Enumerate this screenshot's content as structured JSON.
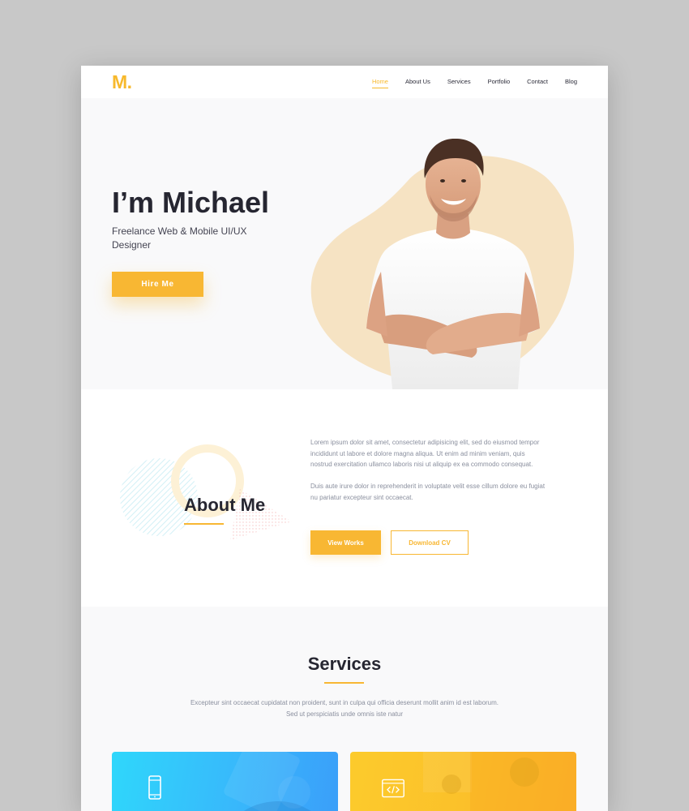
{
  "nav": {
    "logo": "M.",
    "items": [
      {
        "label": "Home",
        "active": true
      },
      {
        "label": "About Us"
      },
      {
        "label": "Services"
      },
      {
        "label": "Portfolio"
      },
      {
        "label": "Contact"
      },
      {
        "label": "Blog"
      }
    ]
  },
  "hero": {
    "title": "I’m Michael",
    "subtitle": "Freelance Web & Mobile UI/UX Designer",
    "cta": "Hire Me"
  },
  "about": {
    "title": "About Me",
    "paragraphs": [
      "Lorem ipsum dolor sit amet, consectetur adipisicing elit, sed do eiusmod tempor incididunt ut labore et dolore magna aliqua. Ut enim ad minim veniam, quis nostrud exercitation ullamco laboris nisi ut aliquip ex ea commodo consequat.",
      "Duis aute irure dolor in reprehenderit in voluptate velit esse cillum dolore eu fugiat nu pariatur excepteur sint occaecat."
    ],
    "primary_btn": "View Works",
    "secondary_btn": "Download CV"
  },
  "services": {
    "title": "Services",
    "description": "Excepteur sint occaecat cupidatat non proident, sunt in culpa qui officia deserunt mollit anim id est laborum. Sed ut perspiciatis unde omnis iste natur",
    "cards": [
      {
        "icon": "mobile-icon",
        "color": "#38b8fb"
      },
      {
        "icon": "code-window-icon",
        "color": "#fbc02a"
      }
    ]
  },
  "colors": {
    "accent": "#f8b733",
    "heading": "#262631",
    "body_text": "#8a8f9e"
  }
}
